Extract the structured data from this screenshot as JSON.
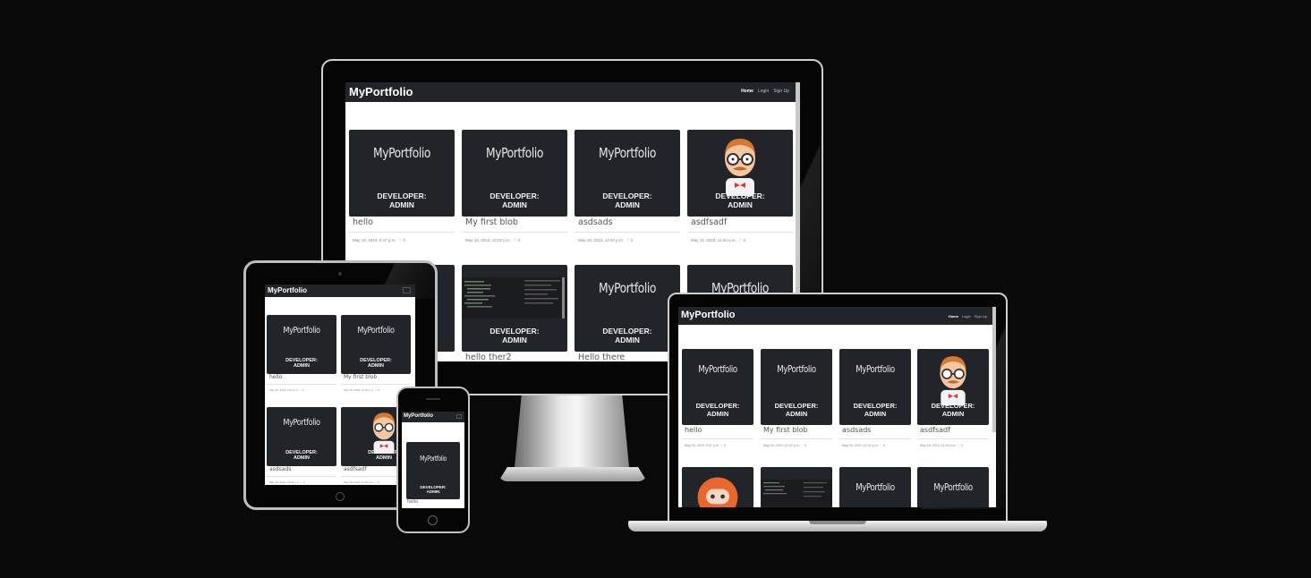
{
  "site": {
    "brand": "MyPortfolio",
    "nav": {
      "home": "Home",
      "login": "Login",
      "signup": "Sign Up"
    },
    "logo_text": "MyPortfolio",
    "developer_label": "DEVELOPER:",
    "developer_name": "ADMIN",
    "likes": "0"
  },
  "posts": [
    {
      "title": "hello",
      "date": "May 18, 2023, 5:47 p.m."
    },
    {
      "title": "My first blob",
      "date": "May 18, 2023, 12:02 p.m."
    },
    {
      "title": "asdsads",
      "date": "May 18, 2023, 12:02 p.m."
    },
    {
      "title": "asdfsadf",
      "date": "May 18, 2023, 11:54 a.m."
    },
    {
      "title": "hello ther2"
    },
    {
      "title": "Hello there"
    }
  ]
}
